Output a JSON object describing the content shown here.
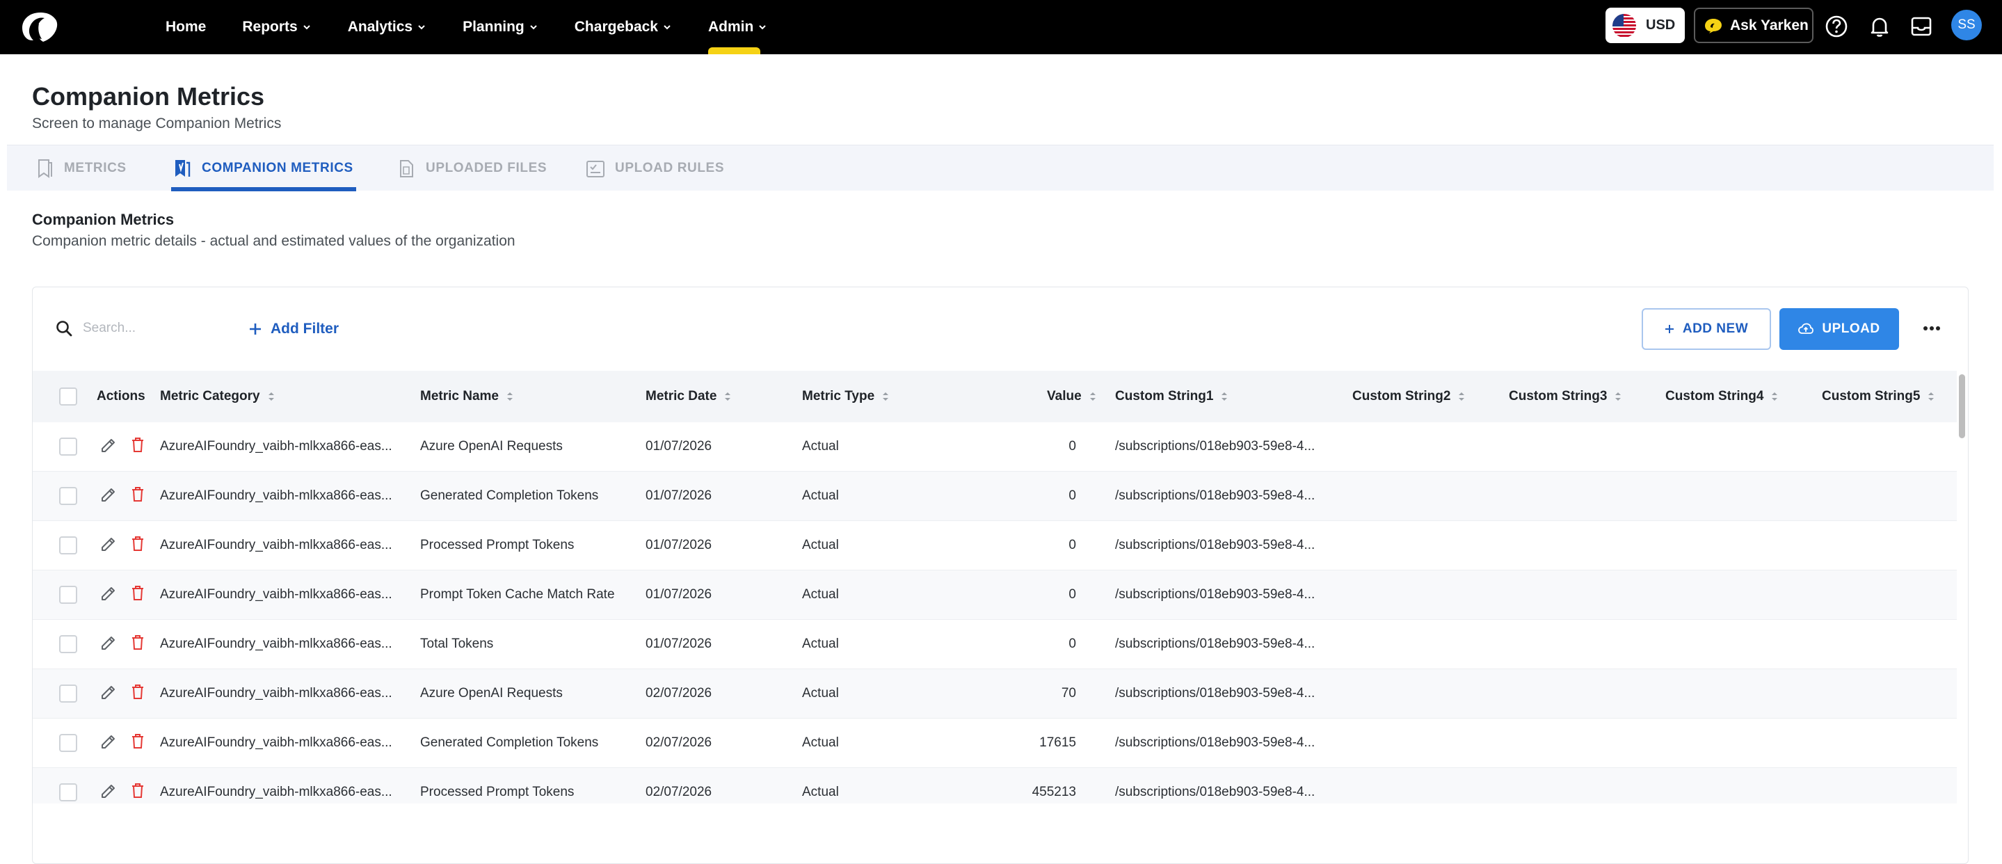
{
  "nav": {
    "items": [
      {
        "label": "Home",
        "dropdown": false
      },
      {
        "label": "Reports",
        "dropdown": true
      },
      {
        "label": "Analytics",
        "dropdown": true
      },
      {
        "label": "Planning",
        "dropdown": true
      },
      {
        "label": "Chargeback",
        "dropdown": true
      },
      {
        "label": "Admin",
        "dropdown": true,
        "active": true
      }
    ],
    "currency": "USD",
    "ask_label": "Ask Yarken",
    "avatar_initials": "SS",
    "accent_color": "#f5d215"
  },
  "header": {
    "title": "Companion Metrics",
    "subtitle": "Screen to manage Companion Metrics"
  },
  "tabs": [
    {
      "label": "METRICS",
      "icon": "bookmark-icon"
    },
    {
      "label": "COMPANION METRICS",
      "icon": "companion-metrics-icon",
      "active": true
    },
    {
      "label": "UPLOADED FILES",
      "icon": "file-icon"
    },
    {
      "label": "UPLOAD RULES",
      "icon": "checklist-icon"
    }
  ],
  "section": {
    "title": "Companion Metrics",
    "description": "Companion metric details - actual and estimated values of the organization"
  },
  "toolbar": {
    "search_placeholder": "Search...",
    "add_filter_label": "Add Filter",
    "add_new_label": "ADD NEW",
    "upload_label": "UPLOAD",
    "primary_color": "#2f86e6"
  },
  "table": {
    "columns": [
      "Actions",
      "Metric Category",
      "Metric Name",
      "Metric Date",
      "Metric Type",
      "Value",
      "Custom String1",
      "Custom String2",
      "Custom String3",
      "Custom String4",
      "Custom String5"
    ],
    "rows": [
      {
        "category": "AzureAIFoundry_vaibh-mlkxa866-eas...",
        "name": "Azure OpenAI Requests",
        "date": "01/07/2026",
        "type": "Actual",
        "value": "0",
        "cs1": "/subscriptions/018eb903-59e8-4..."
      },
      {
        "category": "AzureAIFoundry_vaibh-mlkxa866-eas...",
        "name": "Generated Completion Tokens",
        "date": "01/07/2026",
        "type": "Actual",
        "value": "0",
        "cs1": "/subscriptions/018eb903-59e8-4..."
      },
      {
        "category": "AzureAIFoundry_vaibh-mlkxa866-eas...",
        "name": "Processed Prompt Tokens",
        "date": "01/07/2026",
        "type": "Actual",
        "value": "0",
        "cs1": "/subscriptions/018eb903-59e8-4..."
      },
      {
        "category": "AzureAIFoundry_vaibh-mlkxa866-eas...",
        "name": "Prompt Token Cache Match Rate",
        "date": "01/07/2026",
        "type": "Actual",
        "value": "0",
        "cs1": "/subscriptions/018eb903-59e8-4..."
      },
      {
        "category": "AzureAIFoundry_vaibh-mlkxa866-eas...",
        "name": "Total Tokens",
        "date": "01/07/2026",
        "type": "Actual",
        "value": "0",
        "cs1": "/subscriptions/018eb903-59e8-4..."
      },
      {
        "category": "AzureAIFoundry_vaibh-mlkxa866-eas...",
        "name": "Azure OpenAI Requests",
        "date": "02/07/2026",
        "type": "Actual",
        "value": "70",
        "cs1": "/subscriptions/018eb903-59e8-4..."
      },
      {
        "category": "AzureAIFoundry_vaibh-mlkxa866-eas...",
        "name": "Generated Completion Tokens",
        "date": "02/07/2026",
        "type": "Actual",
        "value": "17615",
        "cs1": "/subscriptions/018eb903-59e8-4..."
      },
      {
        "category": "AzureAIFoundry_vaibh-mlkxa866-eas...",
        "name": "Processed Prompt Tokens",
        "date": "02/07/2026",
        "type": "Actual",
        "value": "455213",
        "cs1": "/subscriptions/018eb903-59e8-4..."
      }
    ]
  }
}
